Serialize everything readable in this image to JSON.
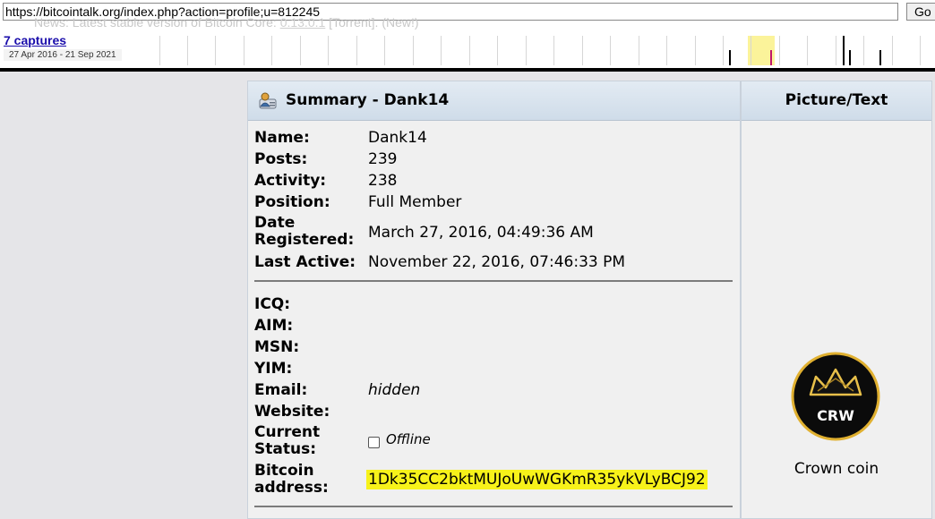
{
  "wayback": {
    "url": "https://bitcointalk.org/index.php?action=profile;u=812245",
    "go_label": "Go",
    "captures_label": "7 captures",
    "date_range": "27 Apr 2016 - 21 Sep 2021",
    "ghost_news": "News: Latest stable version of Bitcoin Core: ",
    "ghost_version": "0.13.0.1",
    "ghost_rest": "  [Torrent]. (New!)"
  },
  "summary": {
    "header": "Summary - Dank14",
    "fields": {
      "name_label": "Name:",
      "name_value": "Dank14",
      "posts_label": "Posts:",
      "posts_value": "239",
      "activity_label": "Activity:",
      "activity_value": "238",
      "position_label": "Position:",
      "position_value": "Full Member",
      "date_label_1": "Date",
      "date_label_2": "Registered:",
      "date_value": "March 27, 2016, 04:49:36 AM",
      "last_label": "Last Active:",
      "last_value": "November 22, 2016, 07:46:33 PM",
      "icq_label": "ICQ:",
      "aim_label": "AIM:",
      "msn_label": "MSN:",
      "yim_label": "YIM:",
      "email_label": "Email:",
      "email_value": "hidden",
      "website_label": "Website:",
      "status_label_1": "Current",
      "status_label_2": "Status:",
      "status_value": "Offline",
      "btc_label_1": "Bitcoin",
      "btc_label_2": "address:",
      "btc_value": "1Dk35CC2bktMUJoUwWGKmR35ykVLyBCJ92"
    }
  },
  "picture": {
    "header": "Picture/Text",
    "logo_text": "CRW",
    "caption": "Crown coin"
  },
  "icons": {
    "profile": "user-profile-icon",
    "status": "checkbox-icon"
  },
  "colors": {
    "highlight": "#f7f21a",
    "link": "#1a0dab",
    "header_gradient_top": "#e3ebf3",
    "logo_gold": "#e0b030"
  }
}
